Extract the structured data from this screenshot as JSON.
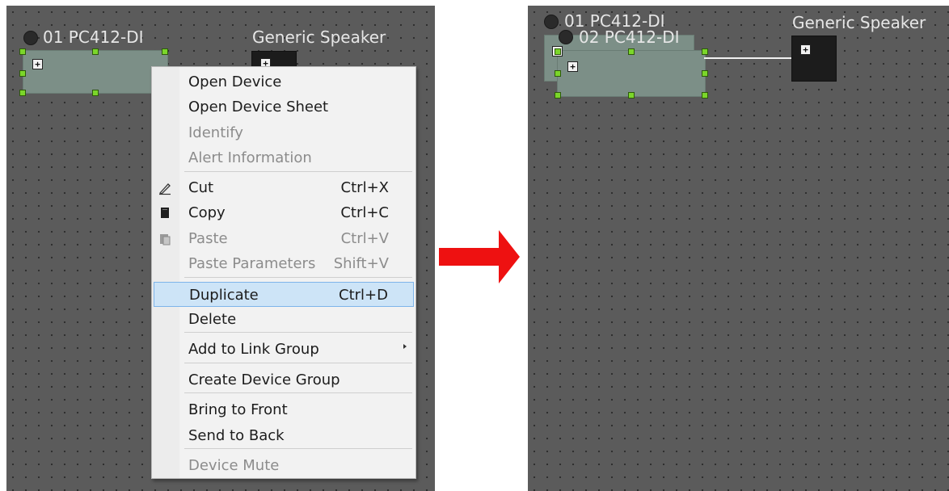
{
  "left_panel": {
    "device_label": "01 PC412-DI",
    "speaker_label": "Generic Speaker"
  },
  "context_menu": {
    "items": [
      {
        "label": "Open Device",
        "shortcut": "",
        "disabled": false,
        "highlighted": false,
        "icon": ""
      },
      {
        "label": "Open Device Sheet",
        "shortcut": "",
        "disabled": false,
        "highlighted": false,
        "icon": ""
      },
      {
        "label": "Identify",
        "shortcut": "",
        "disabled": true,
        "highlighted": false,
        "icon": ""
      },
      {
        "label": "Alert Information",
        "shortcut": "",
        "disabled": true,
        "highlighted": false,
        "icon": ""
      },
      {
        "label": "Cut",
        "shortcut": "Ctrl+X",
        "disabled": false,
        "highlighted": false,
        "icon": "cut-icon"
      },
      {
        "label": "Copy",
        "shortcut": "Ctrl+C",
        "disabled": false,
        "highlighted": false,
        "icon": "copy-icon"
      },
      {
        "label": "Paste",
        "shortcut": "Ctrl+V",
        "disabled": true,
        "highlighted": false,
        "icon": "paste-icon"
      },
      {
        "label": "Paste Parameters",
        "shortcut": "Shift+V",
        "disabled": true,
        "highlighted": false,
        "icon": ""
      },
      {
        "label": "Duplicate",
        "shortcut": "Ctrl+D",
        "disabled": false,
        "highlighted": true,
        "icon": ""
      },
      {
        "label": "Delete",
        "shortcut": "",
        "disabled": false,
        "highlighted": false,
        "icon": ""
      },
      {
        "label": "Add to Link Group",
        "shortcut": "",
        "disabled": false,
        "highlighted": false,
        "icon": "",
        "submenu": true
      },
      {
        "label": "Create Device Group",
        "shortcut": "",
        "disabled": false,
        "highlighted": false,
        "icon": ""
      },
      {
        "label": "Bring to Front",
        "shortcut": "",
        "disabled": false,
        "highlighted": false,
        "icon": ""
      },
      {
        "label": "Send to Back",
        "shortcut": "",
        "disabled": false,
        "highlighted": false,
        "icon": ""
      },
      {
        "label": "Device Mute",
        "shortcut": "",
        "disabled": true,
        "highlighted": false,
        "icon": ""
      }
    ]
  },
  "right_panel": {
    "device_label_1": "01 PC412-DI",
    "device_label_2": "02 PC412-DI",
    "speaker_label": "Generic Speaker"
  },
  "colors": {
    "canvas": "#5b5b5b",
    "device_body": "#7c8f87",
    "handle": "#7bd62a",
    "menu_highlight": "#cde4f7",
    "arrow": "#ee1111"
  },
  "icons": {
    "transition_arrow": "right-arrow-icon",
    "expand": "plus-square-icon"
  }
}
